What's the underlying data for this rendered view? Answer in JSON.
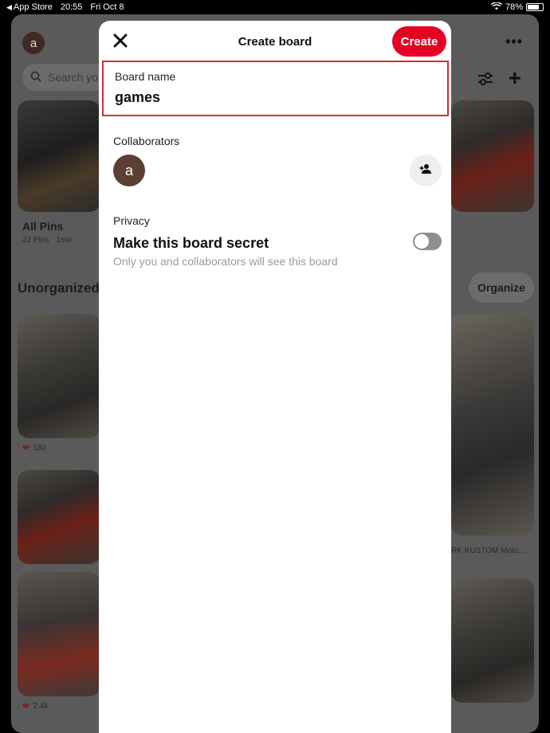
{
  "status_bar": {
    "back_app": "App Store",
    "time": "20:55",
    "date": "Fri Oct 8",
    "battery": "78%",
    "battery_level": 0.78
  },
  "background": {
    "avatar_letter": "a",
    "search_placeholder": "Search yo",
    "all_pins": {
      "title": "All Pins",
      "count": "22 Pins",
      "age": "1mo"
    },
    "section_title": "Unorganized",
    "organize_label": "Organize",
    "pins": [
      {
        "reactions": "180"
      },
      {
        "reactions": "2.4k"
      }
    ],
    "pin_caption": "RK KUSTOM Moto..."
  },
  "modal": {
    "title": "Create board",
    "create_label": "Create",
    "board_name_label": "Board name",
    "board_name_value": "games",
    "collaborators_label": "Collaborators",
    "collaborator_avatar": "a",
    "privacy_label": "Privacy",
    "secret_title": "Make this board secret",
    "secret_desc": "Only you and collaborators will see this board",
    "secret_enabled": false
  },
  "colors": {
    "brand": "#e60023",
    "highlight_border": "#d32f2f"
  },
  "icons": [
    "back-arrow-icon",
    "wifi-icon",
    "battery-icon",
    "search-icon",
    "filter-icon",
    "plus-icon",
    "more-icon",
    "close-icon",
    "add-person-icon",
    "heart-icon"
  ]
}
